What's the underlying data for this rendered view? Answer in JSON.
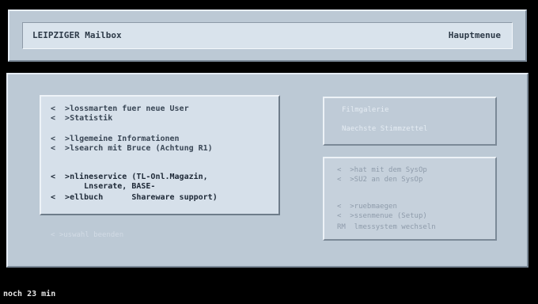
{
  "header": {
    "title": "LEIPZIGER Mailbox",
    "right_label": "Hauptmenue"
  },
  "menu": {
    "items": [
      {
        "label": "<  >lossmarten fuer neue User"
      },
      {
        "label": "<  >Statistik"
      },
      {
        "label": "<  >llgemeine Informationen"
      },
      {
        "label": "<  >lsearch mit Bruce (Achtung R1)"
      },
      {
        "label": "<  >nlineservice (TL-Onl.Magazin,"
      },
      {
        "label": "       Lnserate, BASE-"
      },
      {
        "label": "<  >ellbuch      Shareware support)"
      }
    ]
  },
  "buttons": {
    "top_label": "Filmgalerie",
    "bottom_label": "Naechste Stimmzettel"
  },
  "right_menu": {
    "items": [
      {
        "label": "<  >hat mit dem SysOp"
      },
      {
        "label": "<  >SU2 an den SysOp"
      },
      {
        "label": "<  >ruebmaegen"
      },
      {
        "label": "<  >ssenmenue (Setup)"
      },
      {
        "label": "RM  lmessystem wechseln"
      }
    ]
  },
  "main_footer": "< >uswahl beenden",
  "status": "noch 23 min"
}
